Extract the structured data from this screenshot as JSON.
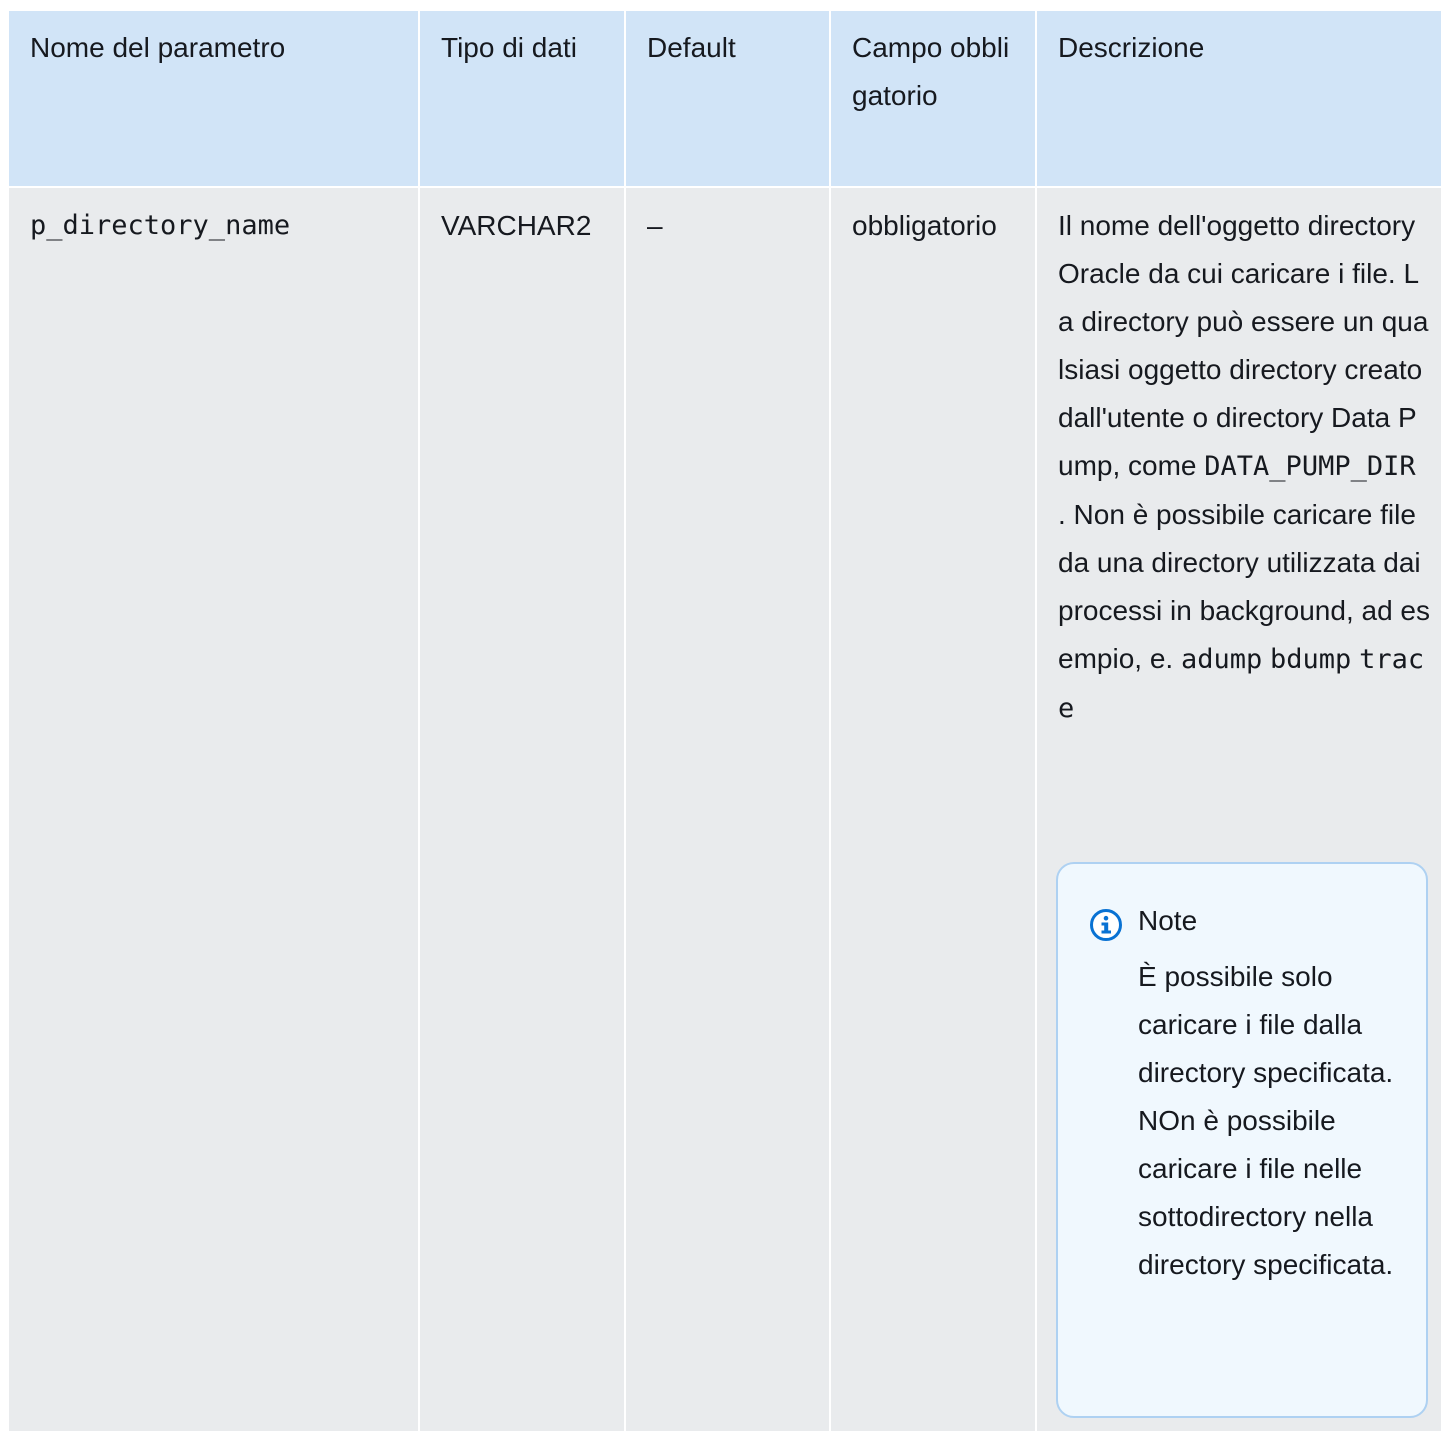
{
  "table": {
    "headers": [
      "Nome del parametro",
      "Tipo di dati",
      "Default",
      "Campo obbligatorio",
      "Descrizione"
    ],
    "row": {
      "parameter_name": "p_directory_name",
      "data_type": "VARCHAR2",
      "default": "–",
      "required": "obbligatorio",
      "description": {
        "text_1": "Il nome dell'oggetto directory Oracle da cui caricare i file. La directory può essere un qualsiasi oggetto directory creato dall'utente o directory Data Pump, come",
        "code_1": "DATA_PUMP_DIR",
        "text_2": ". Non è possibile caricare file da una directory utilizzata dai processi in background, ad esempio, e.",
        "code_2": "adump",
        "code_3": "bdump",
        "code_4": "trace"
      },
      "note": {
        "icon": "info-icon",
        "title": "Note",
        "text": "È possibile solo caricare i file dalla directory specificata. NOn è possibile caricare i file nelle sottodirectory nella directory specificata."
      }
    }
  }
}
